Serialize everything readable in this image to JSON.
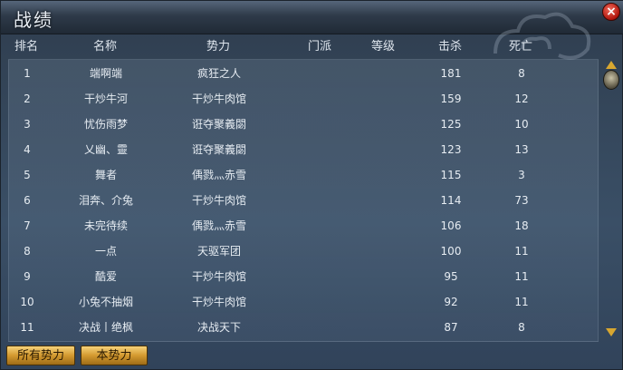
{
  "window": {
    "title": "战绩",
    "close_label": "×"
  },
  "columns": [
    "排名",
    "名称",
    "势力",
    "门派",
    "等级",
    "击杀",
    "死亡"
  ],
  "rows": [
    {
      "rank": "1",
      "name": "端啊端",
      "force": "疯狂之人",
      "sect": "",
      "level": "",
      "kills": "181",
      "deaths": "8"
    },
    {
      "rank": "2",
      "name": "干炒牛河",
      "force": "干炒牛肉馆",
      "sect": "",
      "level": "",
      "kills": "159",
      "deaths": "12"
    },
    {
      "rank": "3",
      "name": "忧伤雨梦",
      "force": "诳夺聚義閟",
      "sect": "",
      "level": "",
      "kills": "125",
      "deaths": "10"
    },
    {
      "rank": "4",
      "name": "乂幽、靈",
      "force": "诳夺聚義閟",
      "sect": "",
      "level": "",
      "kills": "123",
      "deaths": "13"
    },
    {
      "rank": "5",
      "name": "舞者",
      "force": "偊戮灬赤雪",
      "sect": "",
      "level": "",
      "kills": "115",
      "deaths": "3"
    },
    {
      "rank": "6",
      "name": "泪奔、介兔",
      "force": "干炒牛肉馆",
      "sect": "",
      "level": "",
      "kills": "114",
      "deaths": "73"
    },
    {
      "rank": "7",
      "name": "未完待续",
      "force": "偊戮灬赤雪",
      "sect": "",
      "level": "",
      "kills": "106",
      "deaths": "18"
    },
    {
      "rank": "8",
      "name": "一点",
      "force": "天驱军团",
      "sect": "",
      "level": "",
      "kills": "100",
      "deaths": "11"
    },
    {
      "rank": "9",
      "name": "酷爱",
      "force": "干炒牛肉馆",
      "sect": "",
      "level": "",
      "kills": "95",
      "deaths": "11"
    },
    {
      "rank": "10",
      "name": "小兔不抽烟",
      "force": "干炒牛肉馆",
      "sect": "",
      "level": "",
      "kills": "92",
      "deaths": "11"
    },
    {
      "rank": "11",
      "name": "决战丨绝枫",
      "force": "决战天下",
      "sect": "",
      "level": "",
      "kills": "87",
      "deaths": "8"
    }
  ],
  "buttons": {
    "all_forces": "所有势力",
    "own_force": "本势力"
  },
  "colors": {
    "button_gold": "#d49a2f",
    "close_red": "#b0150d",
    "panel_blue": "#34465a"
  }
}
